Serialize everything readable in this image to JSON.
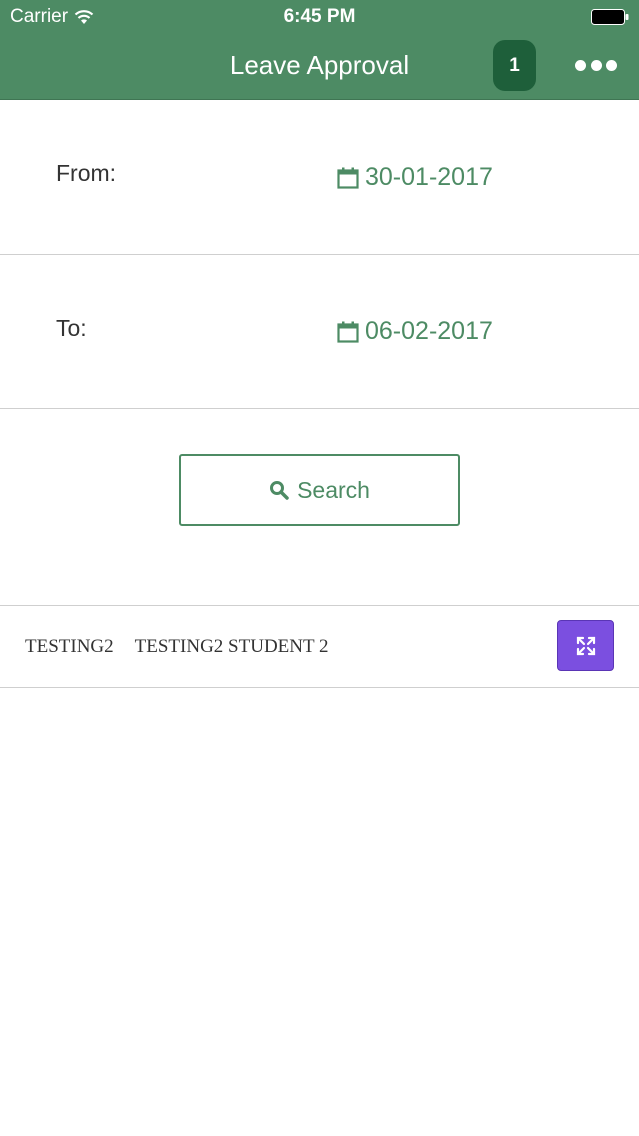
{
  "status_bar": {
    "carrier": "Carrier",
    "time": "6:45 PM"
  },
  "header": {
    "title": "Leave Approval",
    "badge_count": "1",
    "menu_icon": "more-icon"
  },
  "filters": {
    "from_label": "From:",
    "from_date": "30-01-2017",
    "to_label": "To:",
    "to_date": "06-02-2017",
    "date_icon": "calendar-icon"
  },
  "search": {
    "button_label": "Search",
    "icon": "search-icon"
  },
  "results": [
    {
      "id": "TESTING2",
      "name": "TESTING2 STUDENT 2",
      "action_icon": "expand-icon"
    }
  ],
  "colors": {
    "header_bg": "#4d8b64",
    "accent": "#4d8b64",
    "badge_bg": "#1e5f3a",
    "expand_button_bg": "#7b4fe0"
  }
}
